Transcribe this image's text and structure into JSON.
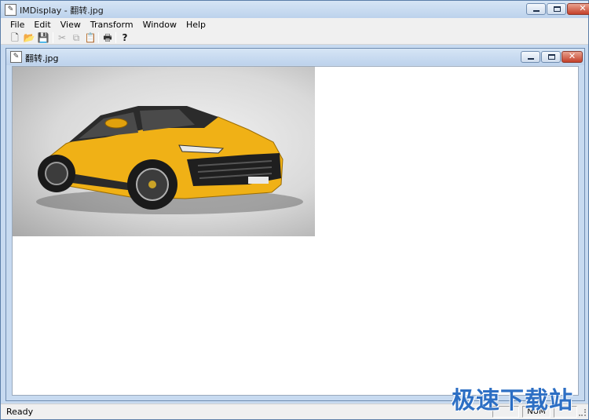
{
  "window": {
    "title": "IMDisplay - 翻转.jpg",
    "icon": "imdisplay-icon",
    "controls": [
      "minimize",
      "maximize",
      "close"
    ]
  },
  "menu": [
    "File",
    "Edit",
    "View",
    "Transform",
    "Window",
    "Help"
  ],
  "toolbar": {
    "buttons": [
      {
        "name": "new",
        "icon": "document-icon",
        "glyph": "🗋",
        "enabled": true
      },
      {
        "name": "open",
        "icon": "folder-open-icon",
        "glyph": "📂",
        "enabled": true
      },
      {
        "name": "save",
        "icon": "floppy-icon",
        "glyph": "💾",
        "enabled": true
      },
      {
        "name": "cut",
        "icon": "scissors-icon",
        "glyph": "✂",
        "enabled": false
      },
      {
        "name": "copy",
        "icon": "copy-icon",
        "glyph": "⧉",
        "enabled": false
      },
      {
        "name": "paste",
        "icon": "paste-icon",
        "glyph": "📋",
        "enabled": false
      },
      {
        "name": "print",
        "icon": "printer-icon",
        "glyph": "🖶",
        "enabled": true
      },
      {
        "name": "help",
        "icon": "help-question-icon",
        "glyph": "?",
        "enabled": true
      }
    ]
  },
  "document": {
    "title": "翻转.jpg",
    "image": {
      "subject": "yellow suv",
      "body_color": "#f0b116"
    }
  },
  "status": {
    "text": "Ready",
    "indicators": [
      "",
      "NUM",
      ""
    ]
  },
  "watermark": "极速下载站"
}
